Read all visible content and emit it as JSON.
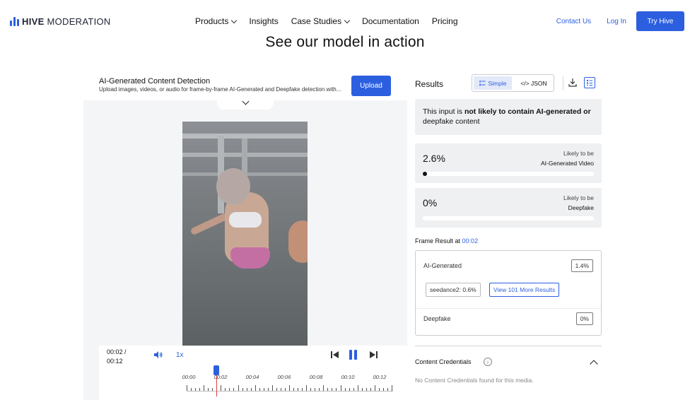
{
  "nav": {
    "brand_bold": "HIVE",
    "brand_light": "MODERATION",
    "links": [
      "Products",
      "Insights",
      "Case Studies",
      "Documentation",
      "Pricing"
    ],
    "contact": "Contact Us",
    "login": "Log In",
    "try": "Try Hive",
    "accent": "#2c5fe0"
  },
  "headline": "See our model in action",
  "detector": {
    "title": "AI-Generated Content Detection",
    "subtitle": "Upload images, videos, or audio for frame-by-frame AI-Generated and Deepfake detection with...",
    "upload": "Upload"
  },
  "player": {
    "time_current": "00:02 /",
    "time_total": "00:12",
    "speed": "1x",
    "timeline": [
      "00:00",
      "00:02",
      "00:04",
      "00:06",
      "00:08",
      "00:10",
      "00:12"
    ]
  },
  "results": {
    "title": "Results",
    "view_simple": "Simple",
    "view_json": "</> JSON",
    "summary_pre": "This input is ",
    "summary_bold": "not likely to contain AI-generated or",
    "summary_post": "deepfake content",
    "scores": [
      {
        "value": "2.6%",
        "caption1": "Likely to be",
        "caption2": "AI-Generated Video",
        "fraction": 0.026
      },
      {
        "value": "0%",
        "caption1": "Likely to be",
        "caption2": "Deepfake",
        "fraction": 0.0
      }
    ],
    "frame_prefix": "Frame Result at",
    "frame_time": "00:02",
    "frame": {
      "ai_label": "AI-Generated",
      "ai_value": "1.4%",
      "chip_model": "seedance2: 0.6%",
      "chip_more": "View 101 More Results",
      "deepfake_label": "Deepfake",
      "deepfake_value": "0%"
    },
    "credentials_title": "Content Credentials",
    "credentials_text": "No Content Credentials found for this media."
  }
}
